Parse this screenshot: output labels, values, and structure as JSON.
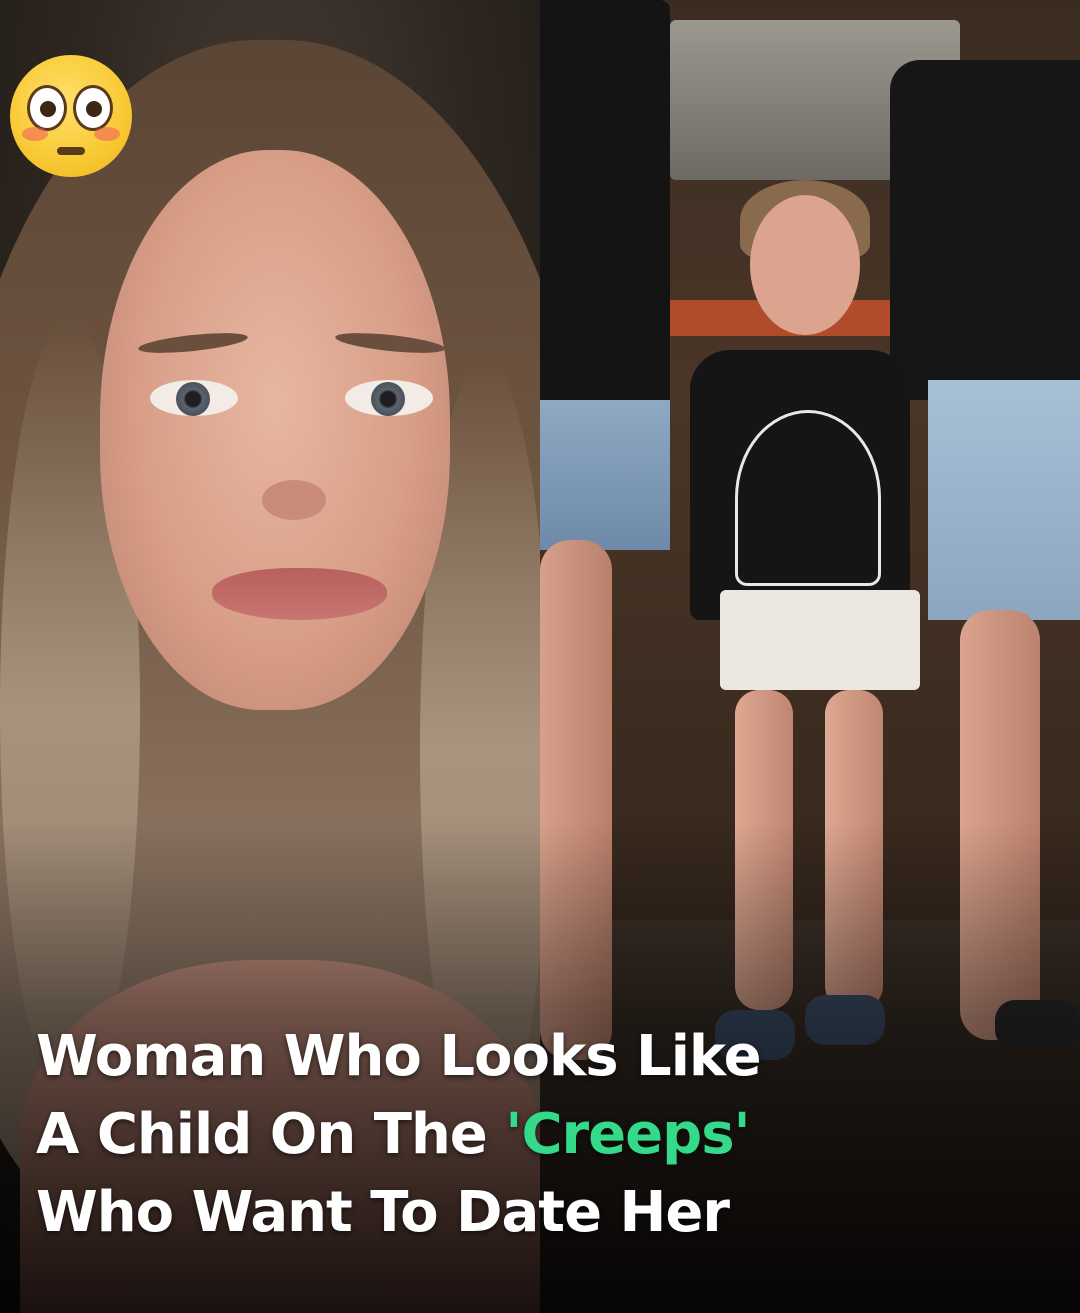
{
  "headline": {
    "line1": "Woman Who Looks Like",
    "line2_prefix": "A Child On The ",
    "line2_highlight": "'Creeps'",
    "line3": "Who Want To Date Her"
  },
  "emoji": {
    "icon": "flushed-face-emoji"
  },
  "colors": {
    "headline_text": "#ffffff",
    "highlight": "#35d98a"
  },
  "photos": {
    "left": "portrait-close-up",
    "right": "group-full-body-shot"
  }
}
